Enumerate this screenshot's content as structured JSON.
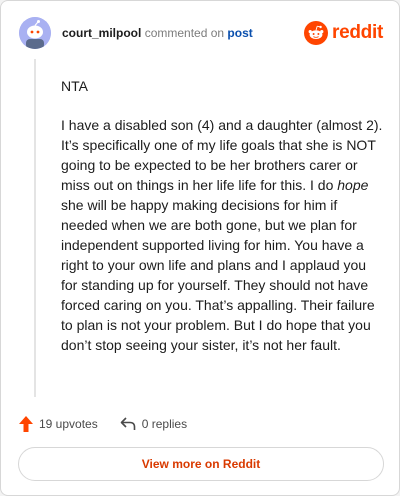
{
  "header": {
    "username": "court_milpool",
    "action_text": "commented on",
    "post_link": "post",
    "logo_text": "reddit"
  },
  "comment": {
    "first_line": "NTA",
    "para_before_em": "I have a disabled son (4) and a daughter (almost 2). It’s specifically one of my life goals that she is NOT going to be expected to be her brothers carer or miss out on things in her life life for this. I do ",
    "para_em": "hope",
    "para_after_em": " she will be happy making decisions for him if needed when we are both gone, but we plan for independent supported living for him. You have a right to your own life and plans and I applaud you for standing up for yourself. They should not have forced caring on you. That’s appalling. Their failure to plan is not your problem. But I do hope that you don’t stop seeing your sister, it’s not her fault."
  },
  "footer": {
    "upvotes": "19 upvotes",
    "replies": "0 replies",
    "view_more": "View more on Reddit"
  },
  "colors": {
    "brand": "#ff4500",
    "link": "#0a4fad",
    "view_more": "#d93a00",
    "upvote_icon": "#ff4500"
  },
  "icons": [
    "snoo-avatar-icon",
    "reddit-logo-icon",
    "upvote-arrow-icon",
    "reply-icon"
  ]
}
